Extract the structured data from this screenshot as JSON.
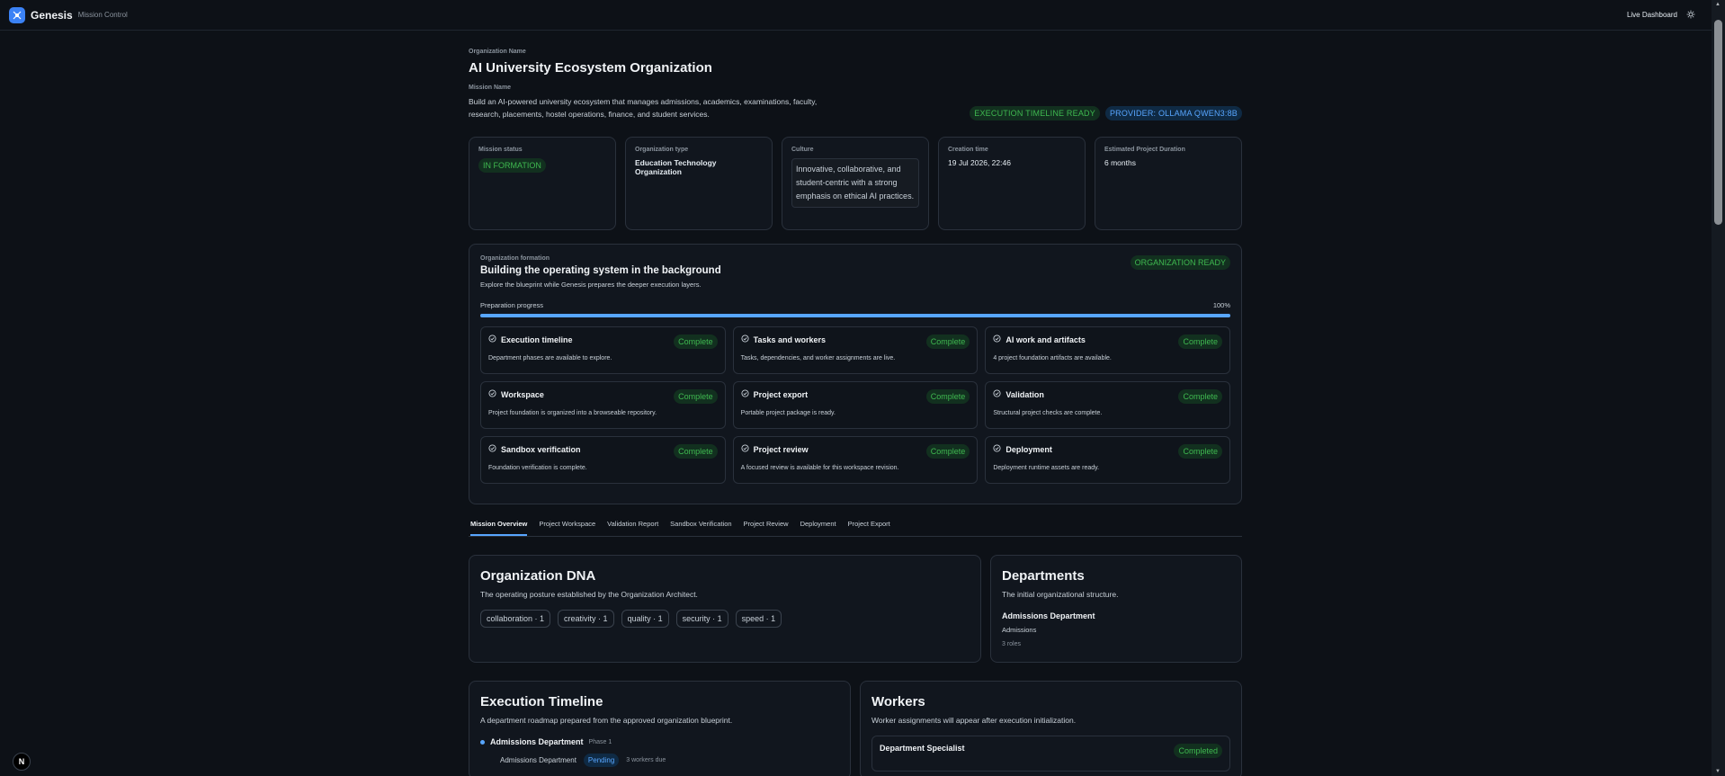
{
  "topbar": {
    "brand": "Genesis",
    "subtitle": "Mission Control",
    "live_dashboard": "Live Dashboard",
    "theme_icon": "sun-icon"
  },
  "header": {
    "org_label": "Organization Name",
    "org_name": "AI University Ecosystem Organization",
    "mission_label": "Mission Name",
    "mission_desc": "Build an AI-powered university ecosystem that manages admissions, academics, examinations, faculty, research, placements, hostel operations, finance, and student services.",
    "badge_timeline": "EXECUTION TIMELINE READY",
    "badge_provider": "PROVIDER: OLLAMA QWEN3:8B"
  },
  "stats": {
    "mission_status_label": "Mission status",
    "mission_status_value": "IN FORMATION",
    "org_type_label": "Organization type",
    "org_type_value": "Education Technology Organization",
    "culture_label": "Culture",
    "culture_value": "Innovative, collaborative, and student-centric with a strong emphasis on ethical AI practices.",
    "creation_label": "Creation time",
    "creation_value": "19 Jul 2026, 22:46",
    "duration_label": "Estimated Project Duration",
    "duration_value": "6 months"
  },
  "formation": {
    "label": "Organization formation",
    "title": "Building the operating system in the background",
    "subtitle": "Explore the blueprint while Genesis prepares the deeper execution layers.",
    "ready_badge": "ORGANIZATION READY",
    "progress_label": "Preparation progress",
    "progress_value": "100%",
    "progress_fraction": 1.0,
    "steps": [
      {
        "name": "Execution timeline",
        "status": "Complete",
        "desc": "Department phases are available to explore."
      },
      {
        "name": "Tasks and workers",
        "status": "Complete",
        "desc": "Tasks, dependencies, and worker assignments are live."
      },
      {
        "name": "AI work and artifacts",
        "status": "Complete",
        "desc": "4 project foundation artifacts are available."
      },
      {
        "name": "Workspace",
        "status": "Complete",
        "desc": "Project foundation is organized into a browseable repository."
      },
      {
        "name": "Project export",
        "status": "Complete",
        "desc": "Portable project package is ready."
      },
      {
        "name": "Validation",
        "status": "Complete",
        "desc": "Structural project checks are complete."
      },
      {
        "name": "Sandbox verification",
        "status": "Complete",
        "desc": "Foundation verification is complete."
      },
      {
        "name": "Project review",
        "status": "Complete",
        "desc": "A focused review is available for this workspace revision."
      },
      {
        "name": "Deployment",
        "status": "Complete",
        "desc": "Deployment runtime assets are ready."
      }
    ]
  },
  "tabs": [
    "Mission Overview",
    "Project Workspace",
    "Validation Report",
    "Sandbox Verification",
    "Project Review",
    "Deployment",
    "Project Export"
  ],
  "dna": {
    "title": "Organization DNA",
    "subtitle": "The operating posture established by the Organization Architect.",
    "chips": [
      "collaboration · 1",
      "creativity · 1",
      "quality · 1",
      "security · 1",
      "speed · 1"
    ]
  },
  "departments": {
    "title": "Departments",
    "subtitle": "The initial organizational structure.",
    "dept_name": "Admissions Department",
    "dept_sub": "Admissions",
    "dept_roles": "3 roles"
  },
  "timeline": {
    "title": "Execution Timeline",
    "subtitle": "A department roadmap prepared from the approved organization blueprint.",
    "item_name": "Admissions Department",
    "item_phase": "Phase 1",
    "sub_name": "Admissions Department",
    "sub_status": "Pending",
    "sub_workers": "3 workers due"
  },
  "workers": {
    "title": "Workers",
    "subtitle": "Worker assignments will appear after execution initialization.",
    "worker_name": "Department Specialist",
    "worker_status": "Completed"
  },
  "floating": {
    "label": "N"
  }
}
